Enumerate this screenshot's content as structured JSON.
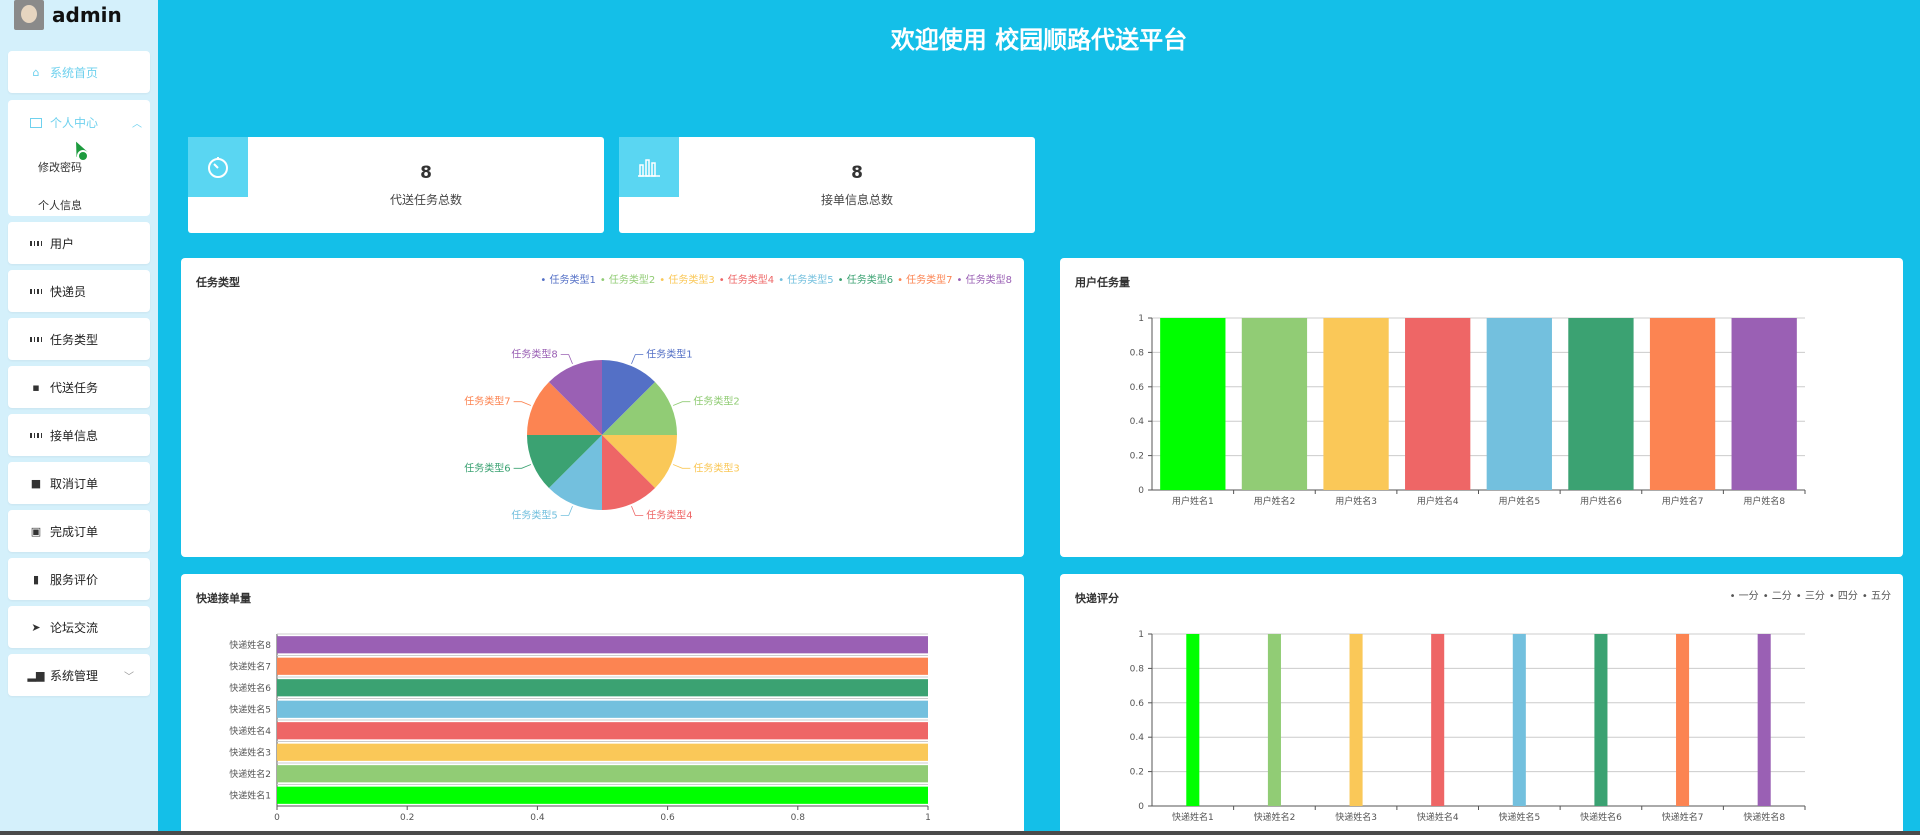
{
  "user": {
    "name": "admin"
  },
  "title": "欢迎使用 校园顺路代送平台",
  "menu": {
    "home": "系统首页",
    "personal": "个人中心",
    "personal_sub": [
      "修改密码",
      "个人信息"
    ],
    "items": [
      "用户",
      "快递员",
      "任务类型",
      "代送任务",
      "接单信息",
      "取消订单",
      "完成订单",
      "服务评价",
      "论坛交流",
      "系统管理"
    ]
  },
  "stats": [
    {
      "value": "8",
      "label": "代送任务总数",
      "icon": "timer-icon"
    },
    {
      "value": "8",
      "label": "接单信息总数",
      "icon": "bar-chart-icon"
    }
  ],
  "colors": [
    "#00ff00",
    "#91cc75",
    "#fac858",
    "#ee6666",
    "#73c0de",
    "#3ba272",
    "#fc8452",
    "#9a60b4"
  ],
  "pie_colors": [
    "#5470c6",
    "#91cc75",
    "#fac858",
    "#ee6666",
    "#73c0de",
    "#3ba272",
    "#fc8452",
    "#9a60b4"
  ],
  "chart_data": [
    {
      "type": "pie",
      "title": "任务类型",
      "categories": [
        "任务类型1",
        "任务类型2",
        "任务类型3",
        "任务类型4",
        "任务类型5",
        "任务类型6",
        "任务类型7",
        "任务类型8"
      ],
      "values": [
        1,
        1,
        1,
        1,
        1,
        1,
        1,
        1
      ],
      "legend": "top-right"
    },
    {
      "type": "bar",
      "title": "用户任务量",
      "categories": [
        "用户姓名1",
        "用户姓名2",
        "用户姓名3",
        "用户姓名4",
        "用户姓名5",
        "用户姓名6",
        "用户姓名7",
        "用户姓名8"
      ],
      "values": [
        1,
        1,
        1,
        1,
        1,
        1,
        1,
        1
      ],
      "ylim": [
        0,
        1
      ],
      "yticks": [
        "0",
        "0.2",
        "0.4",
        "0.6",
        "0.8",
        "1"
      ]
    },
    {
      "type": "bar",
      "orientation": "horizontal",
      "title": "快递接单量",
      "categories": [
        "快递姓名1",
        "快递姓名2",
        "快递姓名3",
        "快递姓名4",
        "快递姓名5",
        "快递姓名6",
        "快递姓名7",
        "快递姓名8"
      ],
      "values": [
        1,
        1,
        1,
        1,
        1,
        1,
        1,
        1
      ],
      "xlim": [
        0,
        1
      ],
      "xticks": [
        "0",
        "0.2",
        "0.4",
        "0.6",
        "0.8",
        "1"
      ]
    },
    {
      "type": "bar",
      "title": "快递评分",
      "categories": [
        "快递姓名1",
        "快递姓名2",
        "快递姓名3",
        "快递姓名4",
        "快递姓名5",
        "快递姓名6",
        "快递姓名7",
        "快递姓名8"
      ],
      "values": [
        1,
        1,
        1,
        1,
        1,
        1,
        1,
        1
      ],
      "ylim": [
        0,
        1
      ],
      "yticks": [
        "0",
        "0.2",
        "0.4",
        "0.6",
        "0.8",
        "1"
      ],
      "legend_entries": [
        "一分",
        "二分",
        "三分",
        "四分",
        "五分"
      ],
      "legend": "top-right"
    }
  ]
}
